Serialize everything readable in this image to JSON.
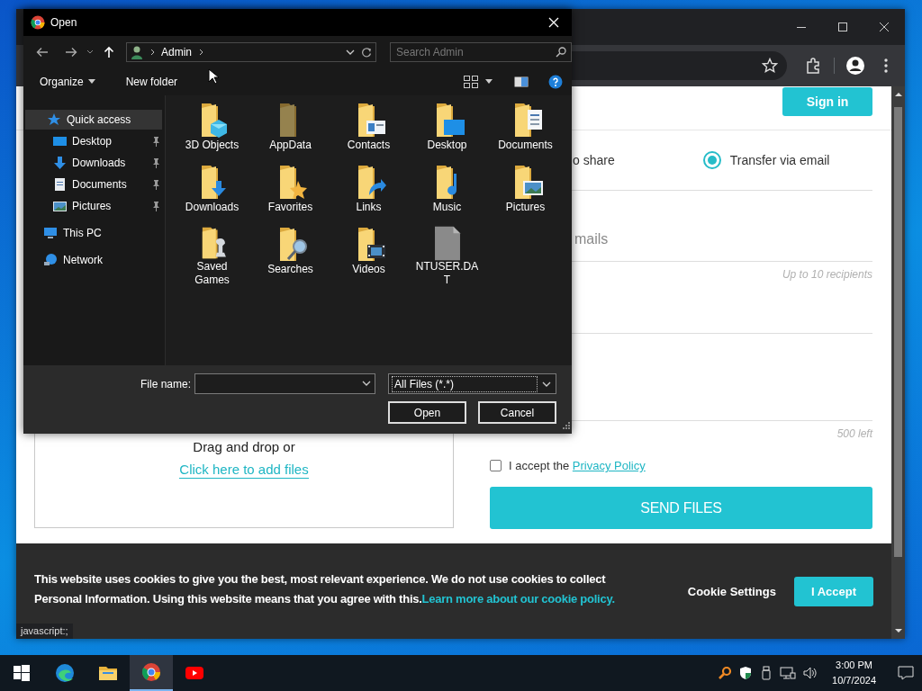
{
  "browser": {
    "page": {
      "sign_in": "Sign in",
      "share_option_partial": "o share",
      "email_option": {
        "label": "Transfer via email",
        "selected": true
      },
      "email_placeholder": "mails",
      "recipients_hint": "Up to 10 recipients",
      "chars_left": "500 left",
      "drop_text": "Drag and drop or",
      "add_files_link": "Click here to add files",
      "accept": {
        "text": "I accept the",
        "link": "Privacy Policy",
        "checked": false
      },
      "send_button": "SEND FILES"
    },
    "cookie_bar": {
      "message": "This website uses cookies to give you the best, most relevant experience. We do not use cookies to collect Personal Information. Using this website means that you agree with this.",
      "link": "Learn more about our cookie policy.",
      "settings": "Cookie Settings",
      "accept": "I Accept"
    },
    "status_url": "javascript:;"
  },
  "dialog": {
    "title": "Open",
    "breadcrumb": "Admin",
    "search_placeholder": "Search Admin",
    "commands": [
      "Organize",
      "New folder"
    ],
    "nav_pane": [
      {
        "label": "Quick access",
        "selected": true,
        "children": [
          {
            "label": "Desktop",
            "selected": false,
            "pinned": true
          },
          {
            "label": "Downloads",
            "selected": false,
            "pinned": true
          },
          {
            "label": "Documents",
            "selected": false,
            "pinned": true
          },
          {
            "label": "Pictures",
            "selected": false,
            "pinned": true
          }
        ]
      },
      {
        "label": "This PC",
        "selected": false
      },
      {
        "label": "Network",
        "selected": false
      }
    ],
    "files": [
      {
        "label": "3D Objects",
        "kind": "folder",
        "hidden": false
      },
      {
        "label": "AppData",
        "kind": "folder",
        "hidden": true
      },
      {
        "label": "Contacts",
        "kind": "folder",
        "hidden": false
      },
      {
        "label": "Desktop",
        "kind": "folder",
        "hidden": false
      },
      {
        "label": "Documents",
        "kind": "folder",
        "hidden": false
      },
      {
        "label": "Downloads",
        "kind": "folder",
        "hidden": false
      },
      {
        "label": "Favorites",
        "kind": "folder",
        "hidden": false
      },
      {
        "label": "Links",
        "kind": "folder",
        "hidden": false
      },
      {
        "label": "Music",
        "kind": "folder",
        "hidden": false
      },
      {
        "label": "Pictures",
        "kind": "folder",
        "hidden": false
      },
      {
        "label": "Saved Games",
        "kind": "folder",
        "hidden": false
      },
      {
        "label": "Searches",
        "kind": "folder",
        "hidden": false
      },
      {
        "label": "Videos",
        "kind": "folder",
        "hidden": false
      },
      {
        "label": "NTUSER.DAT",
        "kind": "file",
        "hidden": false
      }
    ],
    "file_name_label": "File name:",
    "file_type": "All Files (*.*)",
    "buttons": [
      "Open",
      "Cancel"
    ]
  },
  "taskbar": {
    "apps": [
      {
        "selected": false
      },
      {
        "selected": false
      },
      {
        "selected": false
      },
      {
        "selected": true
      },
      {
        "selected": false
      }
    ],
    "time": "3:00 PM",
    "date": "10/7/2024"
  }
}
